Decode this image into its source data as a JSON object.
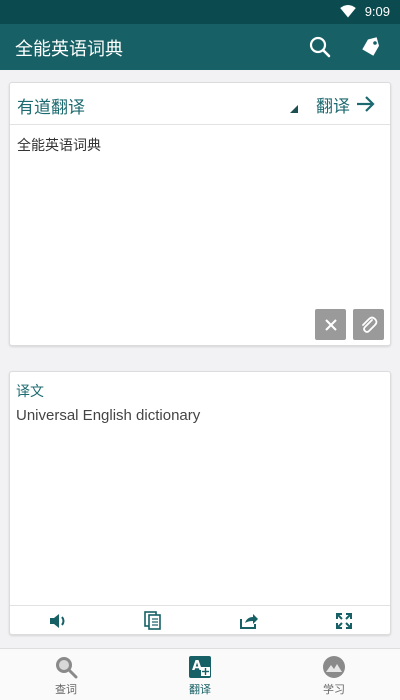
{
  "status": {
    "time": "9:09"
  },
  "app": {
    "title": "全能英语词典"
  },
  "input": {
    "engine": "有道翻译",
    "translate_label": "翻译",
    "text": "全能英语词典"
  },
  "output": {
    "label": "译文",
    "text": "Universal English dictionary"
  },
  "nav": {
    "items": [
      {
        "label": "查词",
        "icon": "search-icon",
        "active": false
      },
      {
        "label": "翻译",
        "icon": "translate-icon",
        "active": true
      },
      {
        "label": "学习",
        "icon": "mountain-icon",
        "active": false
      }
    ]
  },
  "colors": {
    "primary": "#176065",
    "status_bar": "#0b4a4e",
    "accent_text": "#1c6a70"
  }
}
